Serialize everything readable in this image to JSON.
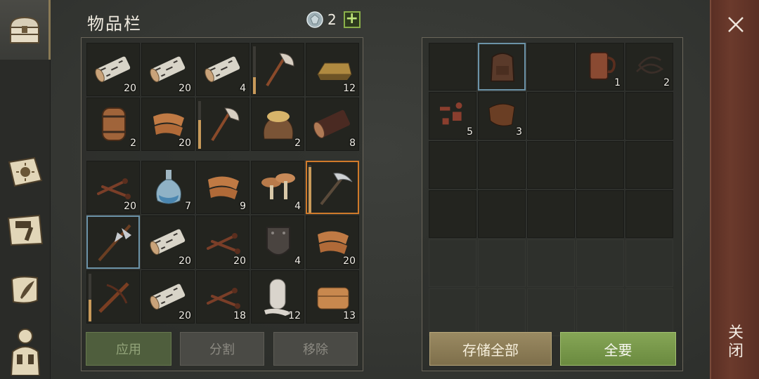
{
  "inventory": {
    "title": "物品栏",
    "currency": {
      "icon": "gem-icon",
      "count": "2"
    },
    "top_slots": [
      {
        "icon": "birch-log-icon",
        "count": "20"
      },
      {
        "icon": "birch-log-icon",
        "count": "20"
      },
      {
        "icon": "birch-log-icon",
        "count": "4"
      },
      {
        "icon": "axe-icon",
        "count": "",
        "durability": 0.35
      },
      {
        "icon": "ingot-icon",
        "count": "12"
      },
      {
        "icon": "barrel-icon",
        "count": "2"
      },
      {
        "icon": "leather-scraps-icon",
        "count": "20"
      },
      {
        "icon": "axe-icon",
        "count": "",
        "durability": 0.6
      },
      {
        "icon": "ore-sack-icon",
        "count": "2"
      },
      {
        "icon": "dark-log-icon",
        "count": "8"
      }
    ],
    "bottom_slots": [
      {
        "icon": "nails-icon",
        "count": "20"
      },
      {
        "icon": "bottle-icon",
        "count": "7"
      },
      {
        "icon": "leather-scraps-icon",
        "count": "9"
      },
      {
        "icon": "mushrooms-icon",
        "count": "4"
      },
      {
        "icon": "pickaxe-icon",
        "count": "",
        "durability": 0.95,
        "selected": "orange"
      },
      {
        "icon": "halberd-icon",
        "count": "",
        "selected": "blue"
      },
      {
        "icon": "birch-log-icon",
        "count": "20"
      },
      {
        "icon": "nails-icon",
        "count": "20"
      },
      {
        "icon": "shield-plate-icon",
        "count": "4"
      },
      {
        "icon": "leather-scraps-icon",
        "count": "20"
      },
      {
        "icon": "crossbow-icon",
        "count": "",
        "durability": 0.45
      },
      {
        "icon": "birch-log-icon",
        "count": "20"
      },
      {
        "icon": "nails-icon",
        "count": "18"
      },
      {
        "icon": "cloth-roll-icon",
        "count": "12"
      },
      {
        "icon": "leather-fold-icon",
        "count": "13"
      }
    ],
    "buttons": {
      "apply": "应用",
      "split": "分割",
      "remove": "移除"
    }
  },
  "storage": {
    "slots": [
      {
        "icon": "",
        "count": ""
      },
      {
        "icon": "backpack-icon",
        "count": "",
        "selected": "blue"
      },
      {
        "icon": "",
        "count": ""
      },
      {
        "icon": "tankard-icon",
        "count": "1"
      },
      {
        "icon": "rope-icon",
        "count": "2"
      },
      {
        "icon": "scrap-parts-icon",
        "count": "5"
      },
      {
        "icon": "leather-piece-icon",
        "count": "3"
      }
    ],
    "buttons": {
      "store_all": "存储全部",
      "take_all": "全要"
    }
  },
  "close_label": "关闭",
  "colors": {
    "accent_green": "#8ab04a",
    "close_panel": "#6b3a2c",
    "select_orange": "#d07a2a",
    "select_blue": "#6c93a8"
  }
}
